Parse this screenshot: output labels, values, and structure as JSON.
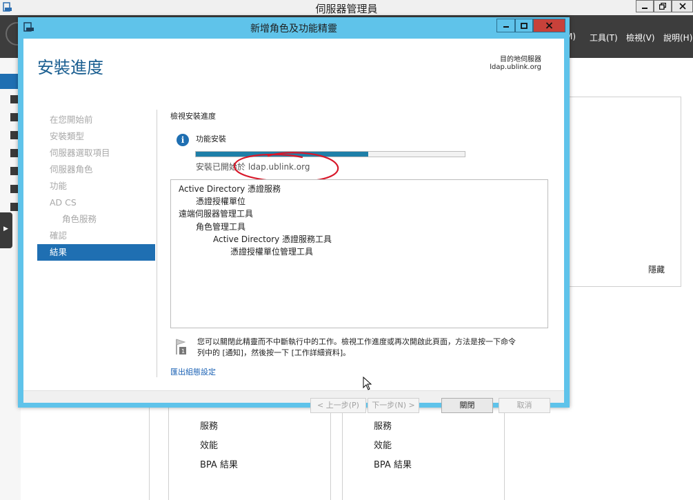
{
  "server_manager": {
    "title": "伺服器管理員",
    "menus": [
      {
        "label": "M)"
      },
      {
        "label": "工具(T)"
      },
      {
        "label": "檢視(V)"
      },
      {
        "label": "說明(H)"
      }
    ],
    "hide_label": "隱藏",
    "tile_items": [
      "服務",
      "效能",
      "BPA 結果"
    ]
  },
  "wizard": {
    "title": "新增角色及功能精靈",
    "heading": "安裝進度",
    "destination_label": "目的地伺服器",
    "destination_server": "ldap.ublink.org",
    "steps": [
      {
        "label": "在您開始前",
        "sub": false,
        "active": false
      },
      {
        "label": "安裝類型",
        "sub": false,
        "active": false
      },
      {
        "label": "伺服器選取項目",
        "sub": false,
        "active": false
      },
      {
        "label": "伺服器角色",
        "sub": false,
        "active": false
      },
      {
        "label": "功能",
        "sub": false,
        "active": false
      },
      {
        "label": "AD CS",
        "sub": false,
        "active": false
      },
      {
        "label": "角色服務",
        "sub": true,
        "active": false
      },
      {
        "label": "確認",
        "sub": false,
        "active": false
      },
      {
        "label": "結果",
        "sub": false,
        "active": true
      }
    ],
    "view_progress_label": "檢視安裝進度",
    "feature_install_label": "功能安裝",
    "progress_fraction": 0.64,
    "install_started_text": "安裝已開始於 ldap.ublink.org",
    "results": [
      {
        "text": "Active Directory 憑證服務",
        "level": 0
      },
      {
        "text": "憑證授權單位",
        "level": 1
      },
      {
        "text": "遠端伺服器管理工具",
        "level": 0
      },
      {
        "text": "角色管理工具",
        "level": 1
      },
      {
        "text": "Active Directory 憑證服務工具",
        "level": 2
      },
      {
        "text": "憑證授權單位管理工具",
        "level": 3
      }
    ],
    "note_line1": "您可以關閉此精靈而不中斷執行中的工作。檢視工作進度或再次開啟此頁面，方法是按一下命令",
    "note_line2": "列中的 [通知]，然後按一下 [工作詳細資料]。",
    "export_link": "匯出組態設定",
    "buttons": {
      "previous": "< 上一步(P)",
      "next": "下一步(N) >",
      "close": "關閉",
      "cancel": "取消"
    }
  },
  "colors": {
    "window_frame": "#5fc3ea",
    "accent": "#1f6fb2",
    "heading": "#1b5f91",
    "progress": "#1e7fa8",
    "annotation": "#d8182a"
  }
}
